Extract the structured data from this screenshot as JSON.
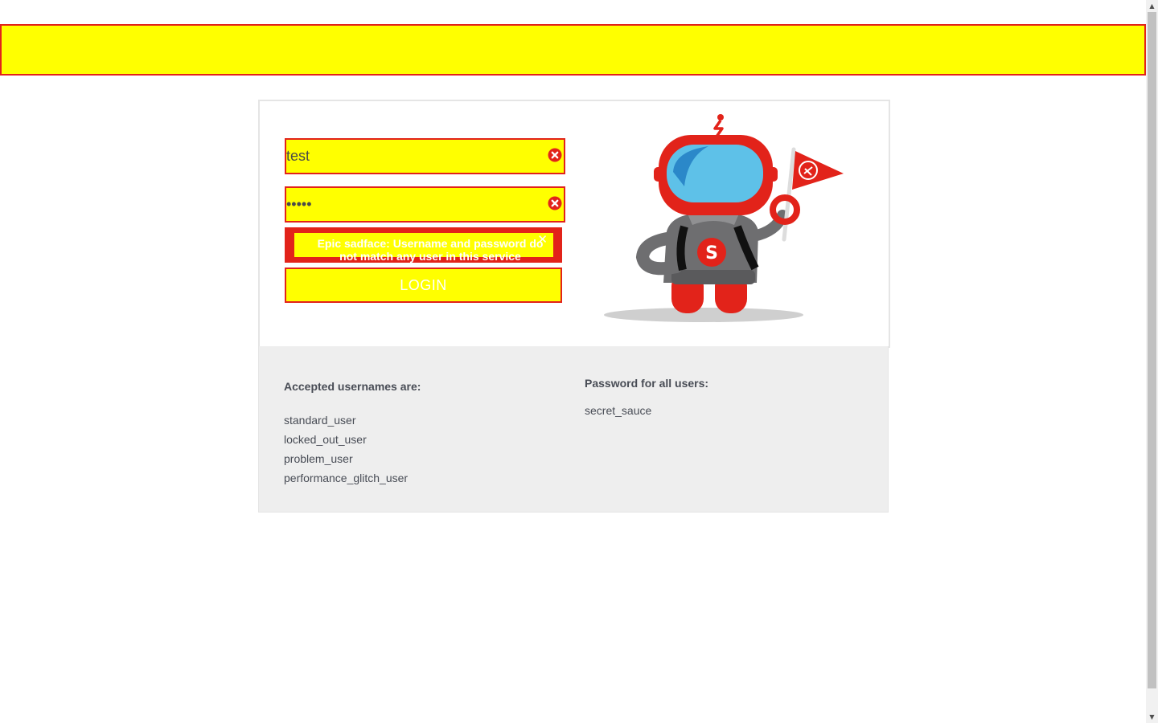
{
  "login": {
    "username_value": "test",
    "password_value": "•••••",
    "error_message": "Epic sadface: Username and password do not match any user in this service",
    "error_close": "✕",
    "login_button": "LOGIN"
  },
  "credentials": {
    "usernames_title": "Accepted usernames are:",
    "usernames": [
      "standard_user",
      "locked_out_user",
      "problem_user",
      "performance_glitch_user"
    ],
    "password_title": "Password for all users:",
    "password": "secret_sauce"
  },
  "icons": {
    "field_clear": "error-circle-icon",
    "error_close": "close-icon",
    "mascot": "robot-mascot"
  },
  "colors": {
    "accent_red": "#e2231a",
    "highlight_yellow": "#ffff00",
    "panel_gray": "#eeeeee",
    "text_gray": "#484c55"
  }
}
